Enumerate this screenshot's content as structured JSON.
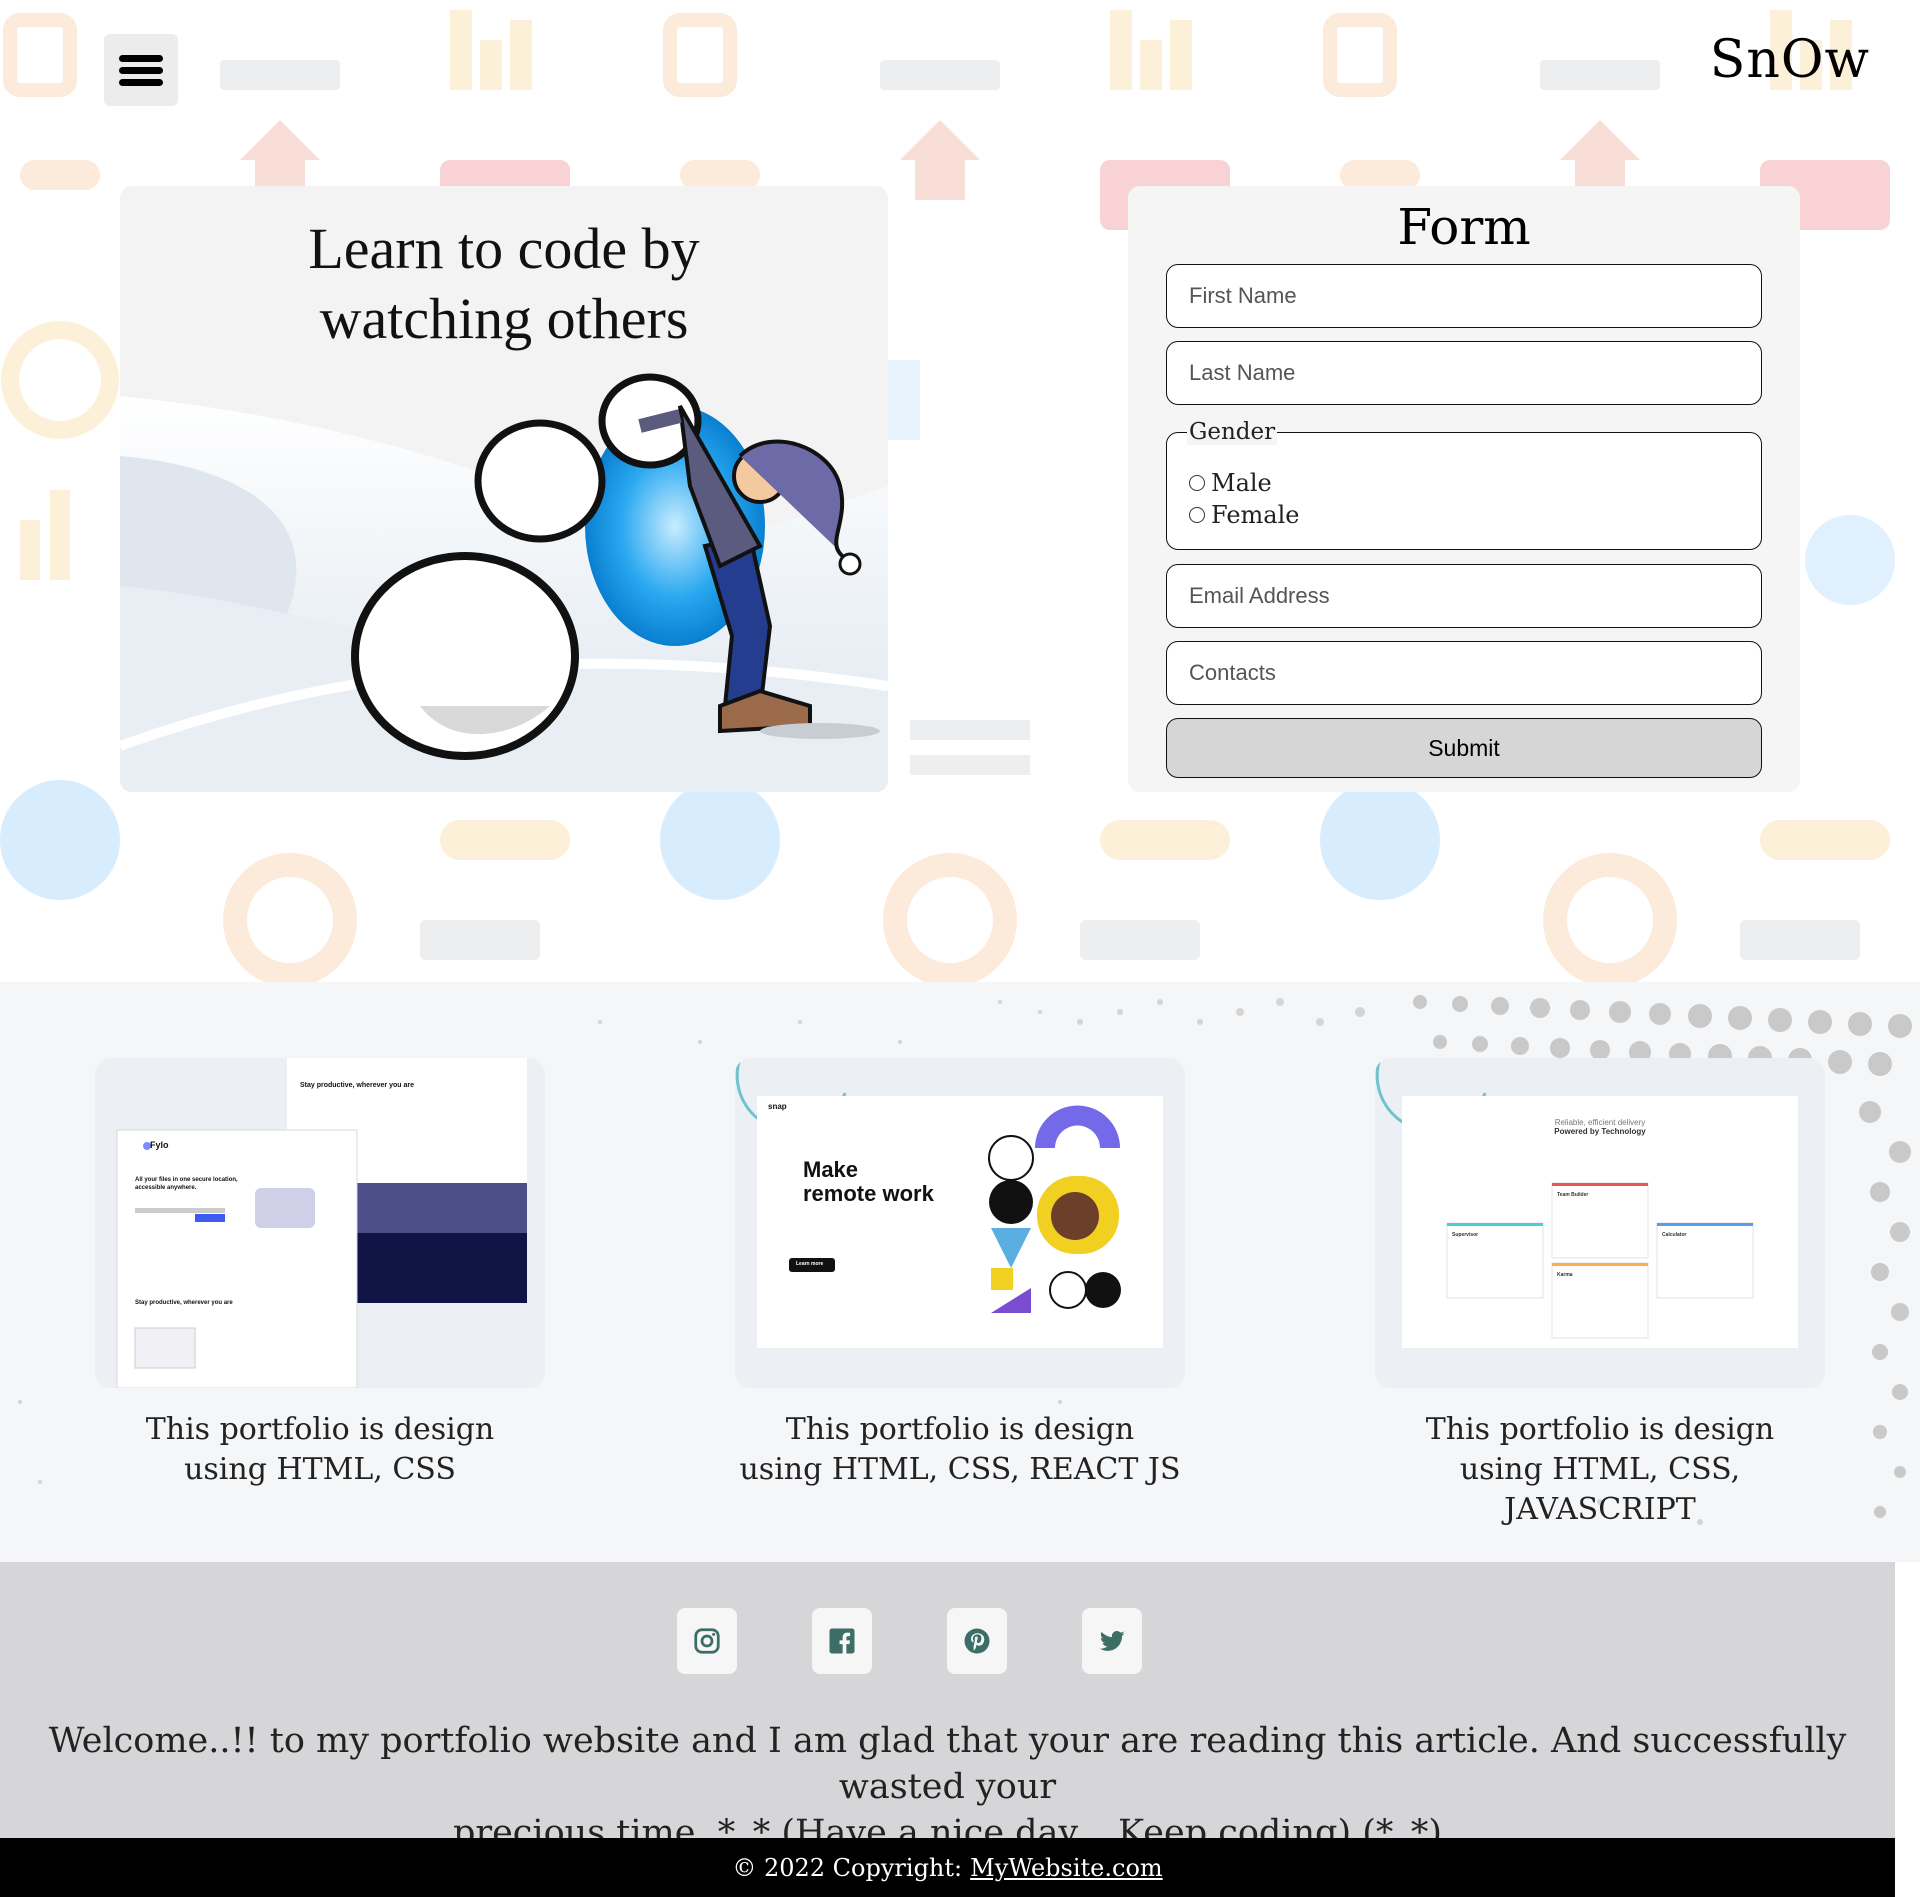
{
  "header": {
    "menu_icon": "hamburger-menu-icon",
    "brand": "SnOw"
  },
  "hero": {
    "title_line1": "Learn to code by",
    "title_line2": "watching others"
  },
  "form": {
    "title": "Form",
    "first_name_placeholder": "First Name",
    "last_name_placeholder": "Last Name",
    "gender_label": "Gender",
    "gender_options": [
      "Male",
      "Female"
    ],
    "email_placeholder": "Email Address",
    "contacts_placeholder": "Contacts",
    "submit_label": "Submit"
  },
  "portfolio": {
    "items": [
      {
        "caption_line1": "This portfolio is design",
        "caption_line2": "using HTML, CSS",
        "shot": {
          "brand": "Fylo",
          "headline": "All your files in one secure location, accessible anywhere.",
          "subhead": "Stay productive, wherever you are",
          "subhead_bottom": "Stay productive, wherever you are"
        }
      },
      {
        "caption_line1": "This portfolio is design",
        "caption_line2": "using HTML, CSS, REACT JS",
        "shot": {
          "brand": "snap",
          "headline_line1": "Make",
          "headline_line2": "remote work",
          "button": "Learn more"
        }
      },
      {
        "caption_line1": "This portfolio is design",
        "caption_line2": "using HTML, CSS, JAVASCRIPT",
        "shot": {
          "headline_line1": "Reliable, efficient delivery",
          "headline_line2": "Powered by Technology",
          "cards": [
            "Team Builder",
            "Supervisor",
            "Calculator",
            "Karma"
          ]
        }
      }
    ]
  },
  "footer": {
    "social": [
      {
        "name": "instagram-icon",
        "color": "#3c6e67"
      },
      {
        "name": "facebook-icon",
        "color": "#3c6e67"
      },
      {
        "name": "pinterest-icon",
        "color": "#3c6e67"
      },
      {
        "name": "twitter-icon",
        "color": "#3c6e67"
      }
    ],
    "welcome_line1": "Welcome..!! to my portfolio website and I am glad that your are reading this article. And successfully wasted your",
    "welcome_line2": "precious time. *_* (Have a nice day....Keep coding) (*_*)",
    "copyright_prefix": "© 2022 Copyright:",
    "copyright_link": "MyWebsite.com"
  }
}
